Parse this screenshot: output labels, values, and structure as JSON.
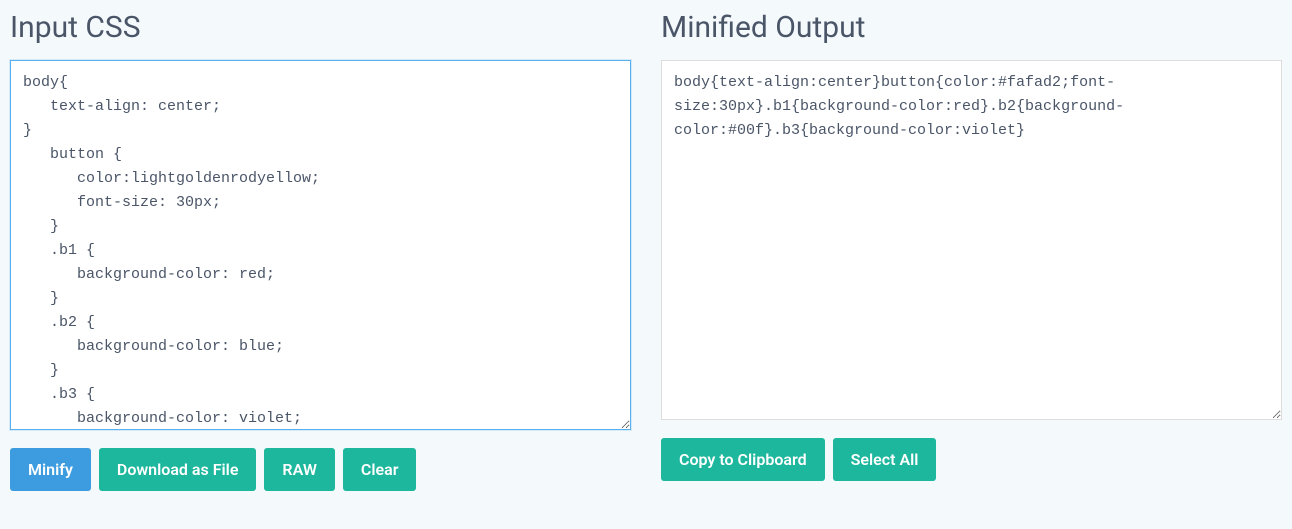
{
  "left": {
    "title": "Input CSS",
    "value": "body{\n   text-align: center;\n}\n   button {\n      color:lightgoldenrodyellow;\n      font-size: 30px;\n   }\n   .b1 {\n      background-color: red;\n   }\n   .b2 {\n      background-color: blue;\n   }\n   .b3 {\n      background-color: violet;\n   }",
    "buttons": {
      "minify": "Minify",
      "download": "Download as File",
      "raw": "RAW",
      "clear": "Clear"
    }
  },
  "right": {
    "title": "Minified Output",
    "value": "body{text-align:center}button{color:#fafad2;font-size:30px}.b1{background-color:red}.b2{background-color:#00f}.b3{background-color:violet}",
    "buttons": {
      "copy": "Copy to Clipboard",
      "select_all": "Select All"
    }
  }
}
